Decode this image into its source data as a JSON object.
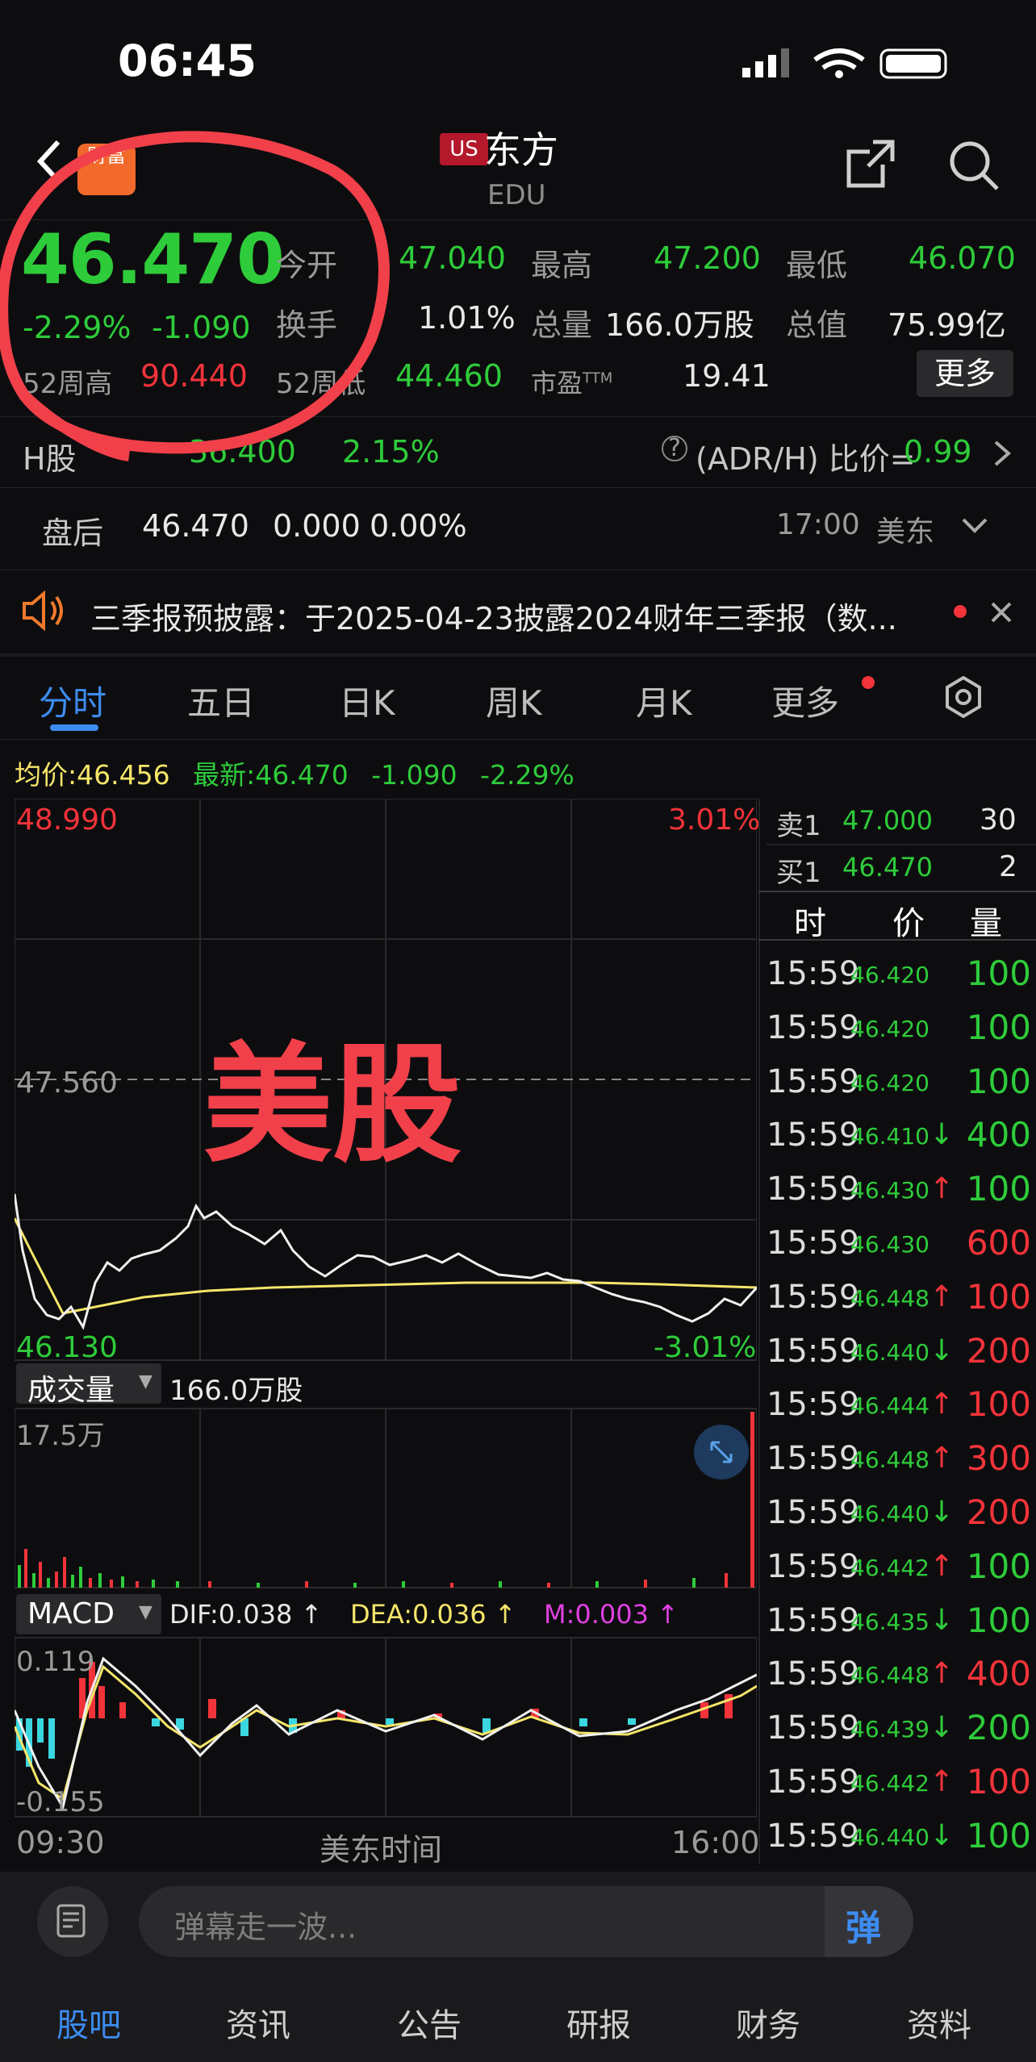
{
  "status_bar": {
    "time": "06:45"
  },
  "header": {
    "badge": "US",
    "logo": "财富",
    "title": "东方",
    "subtitle": "EDU"
  },
  "quote": {
    "price": "46.470",
    "change_pct": "-2.29%",
    "change_amt": "-1.090",
    "week52_high_label": "52周高",
    "week52_high": "90.440",
    "week52_low_label": "52周低",
    "week52_low": "44.460",
    "open_label": "今开",
    "open": "47.040",
    "high_label": "最高",
    "high": "47.200",
    "low_label": "最低",
    "low": "46.070",
    "turnover_label": "换手",
    "turnover": "1.01%",
    "volume_label": "总量",
    "volume": "166.0万股",
    "mktcap_label": "总值",
    "mktcap": "75.99亿",
    "pe_label": "市盈",
    "pe_sup": "TTM",
    "pe": "19.41",
    "more_label": "更多"
  },
  "hk_row": {
    "label": "H股",
    "price": "36.400",
    "pct": "2.15%",
    "ratio_label": "(ADR/H) 比价=",
    "ratio": "0.99"
  },
  "after_hours": {
    "label": "盘后",
    "price": "46.470",
    "change": "0.000",
    "pct": "0.00%",
    "time": "17:00",
    "tz": "美东"
  },
  "notice": {
    "text": "三季报预披露：于2025-04-23披露2024财年三季报（数..."
  },
  "tabs": [
    "分时",
    "五日",
    "日K",
    "周K",
    "月K",
    "更多"
  ],
  "chart_header": {
    "avg_label": "均价:",
    "avg": "46.456",
    "latest_label": "最新:",
    "latest": "46.470",
    "chg": "-1.090",
    "pct": "-2.29%"
  },
  "chart_axis": {
    "top": "48.990",
    "top_pct": "3.01%",
    "mid": "47.560",
    "bottom": "46.130",
    "bottom_pct": "-3.01%"
  },
  "watermark": "美股",
  "volume": {
    "label": "成交量",
    "total": "166.0万股",
    "max": "17.5万"
  },
  "macd": {
    "label": "MACD",
    "dif": "DIF:0.038 ↑",
    "dea": "DEA:0.036 ↑",
    "m": "M:0.003 ↑",
    "top": "0.119",
    "bottom": "-0.155"
  },
  "time_axis": {
    "start": "09:30",
    "label": "美东时间",
    "end": "16:00"
  },
  "orderbook": {
    "ask": {
      "label": "卖1",
      "price": "47.000",
      "qty": "30"
    },
    "bid": {
      "label": "买1",
      "price": "46.470",
      "qty": "2"
    },
    "headers": [
      "时",
      "价",
      "量"
    ]
  },
  "trades": [
    {
      "time": "15:59",
      "price": "46.420",
      "arrow": "",
      "vol": "100",
      "color": "g"
    },
    {
      "time": "15:59",
      "price": "46.420",
      "arrow": "",
      "vol": "100",
      "color": "g"
    },
    {
      "time": "15:59",
      "price": "46.420",
      "arrow": "",
      "vol": "100",
      "color": "g"
    },
    {
      "time": "15:59",
      "price": "46.410",
      "arrow": "↓",
      "vol": "400",
      "color": "g"
    },
    {
      "time": "15:59",
      "price": "46.430",
      "arrow": "↑",
      "vol": "100",
      "color": "g"
    },
    {
      "time": "15:59",
      "price": "46.430",
      "arrow": "",
      "vol": "600",
      "color": "r"
    },
    {
      "time": "15:59",
      "price": "46.448",
      "arrow": "↑",
      "vol": "100",
      "color": "r"
    },
    {
      "time": "15:59",
      "price": "46.440",
      "arrow": "↓",
      "vol": "200",
      "color": "r"
    },
    {
      "time": "15:59",
      "price": "46.444",
      "arrow": "↑",
      "vol": "100",
      "color": "r"
    },
    {
      "time": "15:59",
      "price": "46.448",
      "arrow": "↑",
      "vol": "300",
      "color": "r"
    },
    {
      "time": "15:59",
      "price": "46.440",
      "arrow": "↓",
      "vol": "200",
      "color": "r"
    },
    {
      "time": "15:59",
      "price": "46.442",
      "arrow": "↑",
      "vol": "100",
      "color": "g"
    },
    {
      "time": "15:59",
      "price": "46.435",
      "arrow": "↓",
      "vol": "100",
      "color": "g"
    },
    {
      "time": "15:59",
      "price": "46.448",
      "arrow": "↑",
      "vol": "400",
      "color": "r"
    },
    {
      "time": "15:59",
      "price": "46.439",
      "arrow": "↓",
      "vol": "200",
      "color": "g"
    },
    {
      "time": "15:59",
      "price": "46.442",
      "arrow": "↑",
      "vol": "100",
      "color": "r"
    },
    {
      "time": "15:59",
      "price": "46.440",
      "arrow": "↓",
      "vol": "100",
      "color": "g"
    }
  ],
  "comment": {
    "placeholder": "弹幕走一波...",
    "danmu_btn": "弹"
  },
  "bottom_tabs": [
    "股吧",
    "资讯",
    "公告",
    "研报",
    "财务",
    "资料"
  ]
}
